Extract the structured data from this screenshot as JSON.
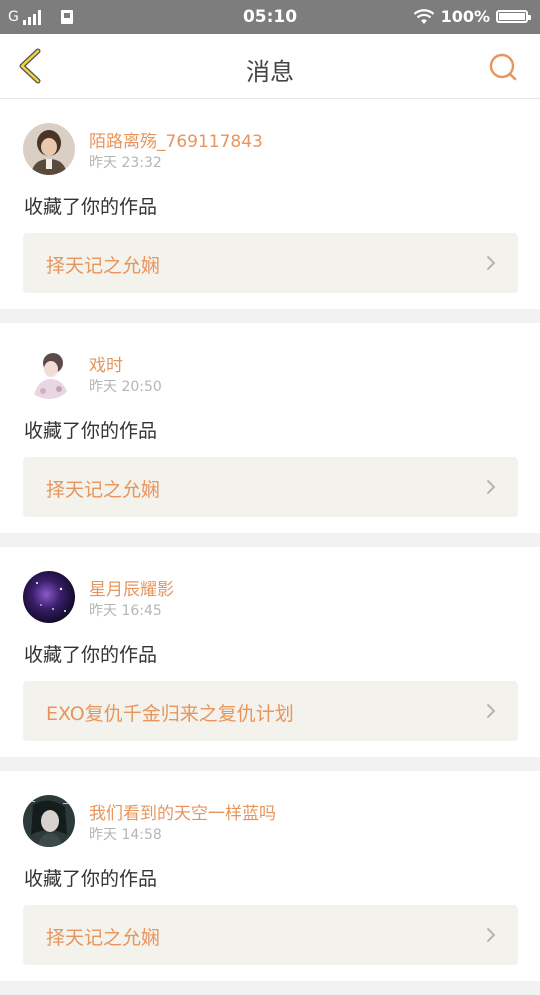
{
  "status_bar": {
    "carrier": "G",
    "time": "05:10",
    "battery": "100%"
  },
  "header": {
    "title": "消息",
    "back_icon": "chevron-left-icon",
    "search_icon": "search-icon",
    "accent_color": "#e8955d"
  },
  "messages": [
    {
      "username": "陌路离殇_769117843",
      "time": "昨天 23:32",
      "action": "收藏了你的作品",
      "work_title": "择天记之允娴"
    },
    {
      "username": "戏时",
      "time": "昨天 20:50",
      "action": "收藏了你的作品",
      "work_title": "择天记之允娴"
    },
    {
      "username": "星月辰耀影",
      "time": "昨天 16:45",
      "action": "收藏了你的作品",
      "work_title": "EXO复仇千金归来之复仇计划"
    },
    {
      "username": "我们看到的天空一样蓝吗",
      "time": "昨天 14:58",
      "action": "收藏了你的作品",
      "work_title": "择天记之允娴"
    }
  ]
}
